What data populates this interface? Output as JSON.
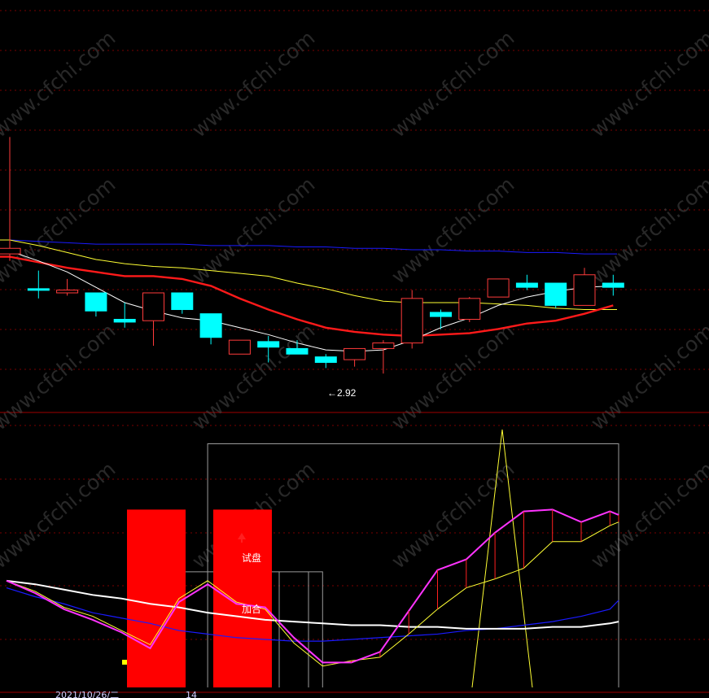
{
  "watermark": "www.cfchi.com",
  "colors": {
    "background": "#000000",
    "up_candle": "#ff3b3b",
    "down_candle": "#00ffff",
    "grid": "#7a0000",
    "ma_white": "#ffffff",
    "ma_red": "#ff1a1a",
    "ma_yellow": "#ffff33",
    "ma_blue": "#1a1aff",
    "bar_red": "#ff0000",
    "line_magenta": "#ff33ff",
    "spike_yellow": "#ffff33"
  },
  "chart_data": [
    {
      "type": "candlestick",
      "title": "",
      "annotations": [
        {
          "text": "←2.92",
          "index": 11
        }
      ],
      "ohlc": [
        {
          "o": 3.74,
          "h": 4.58,
          "l": 3.69,
          "c": 3.78
        },
        {
          "o": 3.49,
          "h": 3.62,
          "l": 3.42,
          "c": 3.48
        },
        {
          "o": 3.46,
          "h": 3.56,
          "l": 3.44,
          "c": 3.48
        },
        {
          "o": 3.46,
          "h": 3.46,
          "l": 3.29,
          "c": 3.33
        },
        {
          "o": 3.27,
          "h": 3.39,
          "l": 3.21,
          "c": 3.25
        },
        {
          "o": 3.26,
          "h": 3.46,
          "l": 3.08,
          "c": 3.46
        },
        {
          "o": 3.46,
          "h": 3.46,
          "l": 3.31,
          "c": 3.34
        },
        {
          "o": 3.31,
          "h": 3.31,
          "l": 3.09,
          "c": 3.14
        },
        {
          "o": 3.02,
          "h": 3.12,
          "l": 3.02,
          "c": 3.12
        },
        {
          "o": 3.11,
          "h": 3.15,
          "l": 2.96,
          "c": 3.07
        },
        {
          "o": 3.06,
          "h": 3.12,
          "l": 3.02,
          "c": 3.02
        },
        {
          "o": 3.0,
          "h": 3.02,
          "l": 2.92,
          "c": 2.96
        },
        {
          "o": 2.98,
          "h": 3.06,
          "l": 2.93,
          "c": 3.06
        },
        {
          "o": 3.06,
          "h": 3.12,
          "l": 2.88,
          "c": 3.1
        },
        {
          "o": 3.1,
          "h": 3.48,
          "l": 3.06,
          "c": 3.42
        },
        {
          "o": 3.32,
          "h": 3.34,
          "l": 3.2,
          "c": 3.29
        },
        {
          "o": 3.27,
          "h": 3.43,
          "l": 3.25,
          "c": 3.42
        },
        {
          "o": 3.43,
          "h": 3.56,
          "l": 3.43,
          "c": 3.56
        },
        {
          "o": 3.53,
          "h": 3.59,
          "l": 3.48,
          "c": 3.5
        },
        {
          "o": 3.53,
          "h": 3.53,
          "l": 3.35,
          "c": 3.37
        },
        {
          "o": 3.37,
          "h": 3.64,
          "l": 3.37,
          "c": 3.59
        },
        {
          "o": 3.53,
          "h": 3.59,
          "l": 3.44,
          "c": 3.5
        }
      ],
      "ma_white": [
        3.76,
        3.69,
        3.61,
        3.5,
        3.39,
        3.33,
        3.28,
        3.26,
        3.21,
        3.16,
        3.1,
        3.05,
        3.04,
        3.05,
        3.12,
        3.21,
        3.28,
        3.37,
        3.43,
        3.47,
        3.5,
        3.51
      ],
      "ma_red": [
        3.72,
        3.68,
        3.64,
        3.61,
        3.58,
        3.58,
        3.56,
        3.51,
        3.42,
        3.34,
        3.27,
        3.21,
        3.18,
        3.16,
        3.15,
        3.16,
        3.17,
        3.2,
        3.24,
        3.26,
        3.31,
        3.37
      ],
      "ma_yellow": [
        3.84,
        3.8,
        3.75,
        3.7,
        3.67,
        3.65,
        3.64,
        3.62,
        3.6,
        3.58,
        3.53,
        3.49,
        3.44,
        3.4,
        3.39,
        3.39,
        3.39,
        3.38,
        3.37,
        3.35,
        3.34,
        3.34
      ],
      "ma_blue": [
        3.84,
        3.83,
        3.82,
        3.81,
        3.81,
        3.81,
        3.81,
        3.8,
        3.8,
        3.8,
        3.79,
        3.79,
        3.78,
        3.78,
        3.77,
        3.77,
        3.76,
        3.76,
        3.75,
        3.75,
        3.74,
        3.74
      ]
    },
    {
      "type": "indicator",
      "labels": [
        {
          "text": "试盘",
          "index": 8
        },
        {
          "text": "加合",
          "index": 8
        }
      ],
      "red_bars": [
        {
          "index": 5,
          "value": 100
        },
        {
          "index": 8,
          "value": 100
        }
      ],
      "magenta_line": [
        60,
        53,
        44,
        38,
        31,
        22,
        48,
        58,
        47,
        45,
        28,
        14,
        14,
        20,
        43,
        66,
        72,
        87,
        99,
        100,
        93,
        99,
        97
      ],
      "yellow_line": [
        60,
        54,
        45,
        40,
        32,
        24,
        50,
        60,
        48,
        44,
        25,
        12,
        15,
        17,
        30,
        44,
        56,
        61,
        67,
        82,
        82,
        91,
        93
      ],
      "white_line": [
        60,
        58,
        55,
        52,
        50,
        47,
        45,
        42,
        40,
        38,
        37,
        36,
        35,
        35,
        34,
        34,
        33,
        33,
        33,
        34,
        34,
        36,
        37
      ],
      "blue_line": [
        56,
        51,
        47,
        42,
        39,
        36,
        32,
        30,
        28,
        27,
        26,
        26,
        27,
        28,
        29,
        30,
        32,
        33,
        35,
        37,
        40,
        44,
        49
      ],
      "yellow_spike": {
        "index": 17,
        "value": 145
      },
      "gray_boxes": [
        {
          "from": 6,
          "to": 11,
          "value": 65
        },
        {
          "from": 7,
          "to": 20,
          "value": 137
        }
      ]
    }
  ],
  "footer": {
    "date": "2021/10/26/二",
    "marker": "14"
  }
}
